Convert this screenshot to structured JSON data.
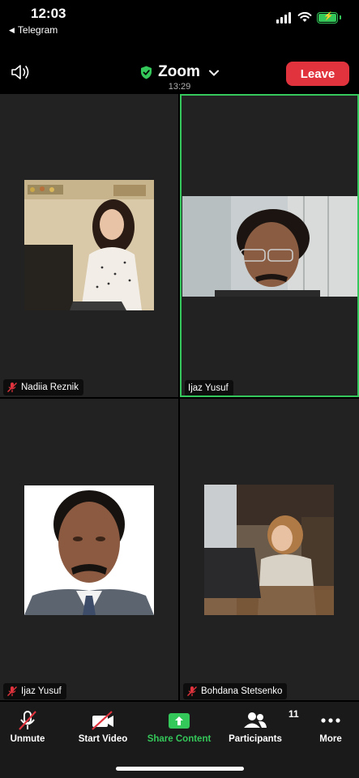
{
  "status_bar": {
    "time": "12:03",
    "back_app": "Telegram",
    "icons": [
      "signal-icon",
      "wifi-icon",
      "battery-charging-icon"
    ],
    "battery_color": "#34c759"
  },
  "header": {
    "title": "Zoom",
    "duration": "13:29",
    "leave_label": "Leave",
    "leave_color": "#e0333d",
    "secure_color": "#34c759"
  },
  "participants": [
    {
      "name": "Nadiia Reznik",
      "muted": true,
      "active_speaker": false
    },
    {
      "name": "Ijaz Yusuf",
      "muted": false,
      "active_speaker": true
    },
    {
      "name": "Ijaz Yusuf",
      "muted": true,
      "active_speaker": false
    },
    {
      "name": "Bohdana Stetsenko",
      "muted": true,
      "active_speaker": false
    }
  ],
  "toolbar": {
    "unmute_label": "Unmute",
    "start_video_label": "Start Video",
    "share_label": "Share Content",
    "participants_label": "Participants",
    "participants_count": "11",
    "more_label": "More",
    "share_color": "#34c759"
  }
}
